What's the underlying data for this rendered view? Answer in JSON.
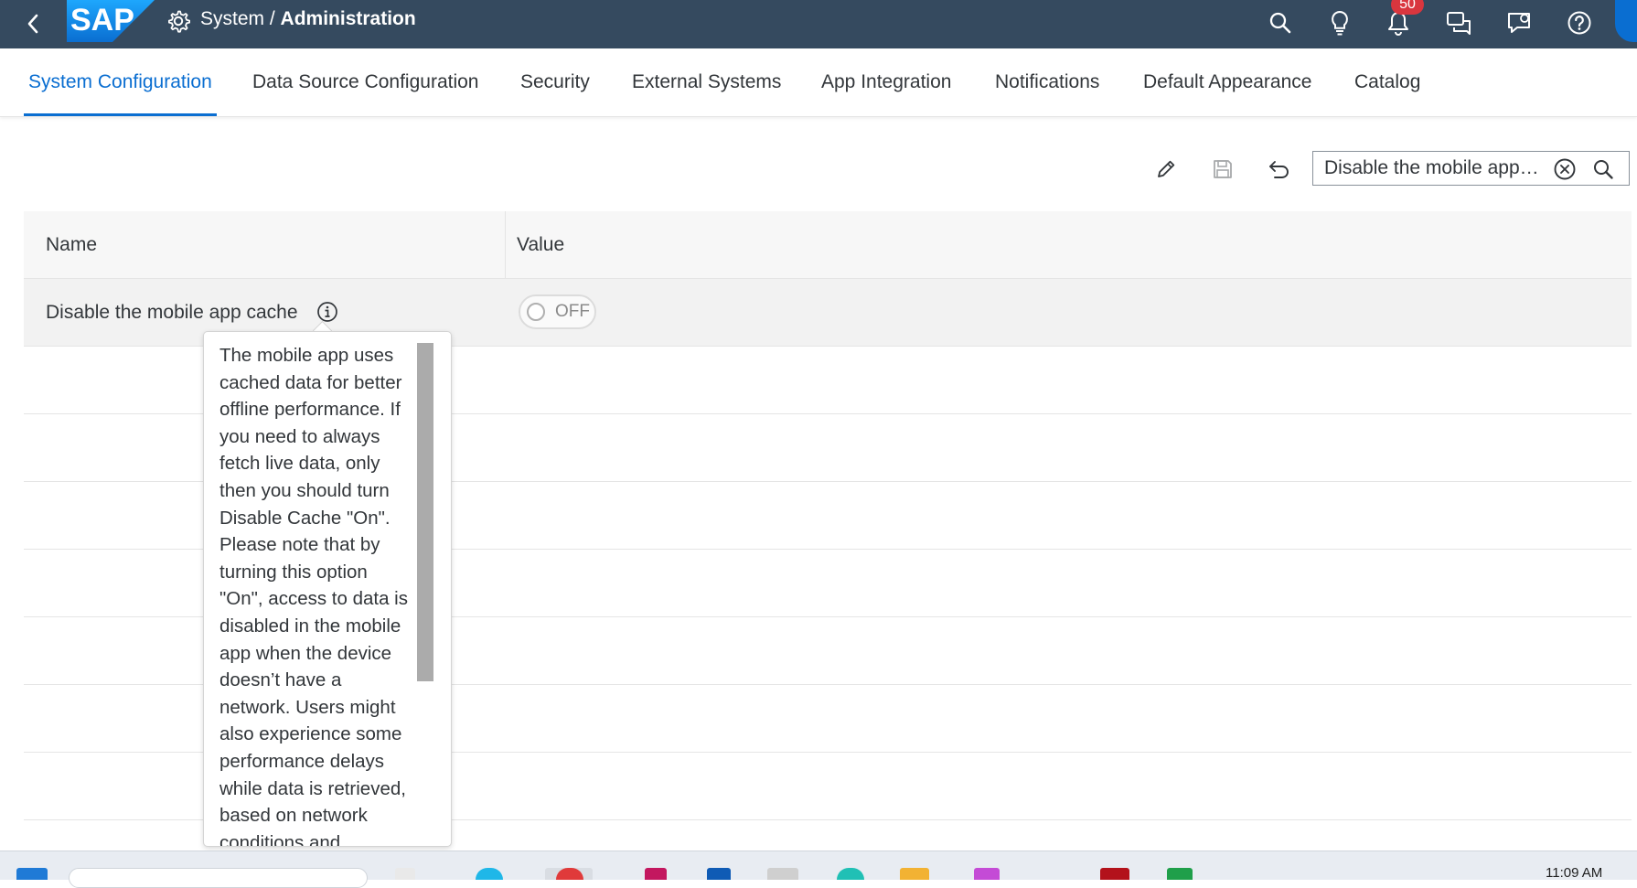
{
  "shell": {
    "logo_text": "SAP",
    "title_prefix": "System / ",
    "title_main": "Administration",
    "notification_count": "50",
    "icons": [
      "search-icon",
      "lightbulb-icon",
      "bell-icon",
      "feedback-icon",
      "chat-icon",
      "help-icon"
    ]
  },
  "tabs": [
    {
      "label": "System Configuration",
      "active": true
    },
    {
      "label": "Data Source Configuration"
    },
    {
      "label": "Security"
    },
    {
      "label": "External Systems"
    },
    {
      "label": "App Integration"
    },
    {
      "label": "Notifications"
    },
    {
      "label": "Default Appearance"
    },
    {
      "label": "Catalog"
    }
  ],
  "toolbar": {
    "search_value": "Disable the mobile app cache"
  },
  "table": {
    "columns": [
      "Name",
      "Value"
    ],
    "rows": [
      {
        "name": "Disable the mobile app cache",
        "value": "OFF"
      }
    ]
  },
  "popover": {
    "text": "The mobile app uses cached data for better offline performance. If you need to always fetch live data, only then you should turn Disable Cache \"On\". Please note that by turning this option \"On\", access to data is disabled in the mobile app when the device doesn’t have a network. Users might also experience some performance delays while data is retrieved, based on network conditions and"
  },
  "taskbar": {
    "clock": "11:09 AM"
  },
  "colors": {
    "shell_bg": "#354a5f",
    "accent": "#0a6ed1",
    "badge": "#d9363e"
  }
}
